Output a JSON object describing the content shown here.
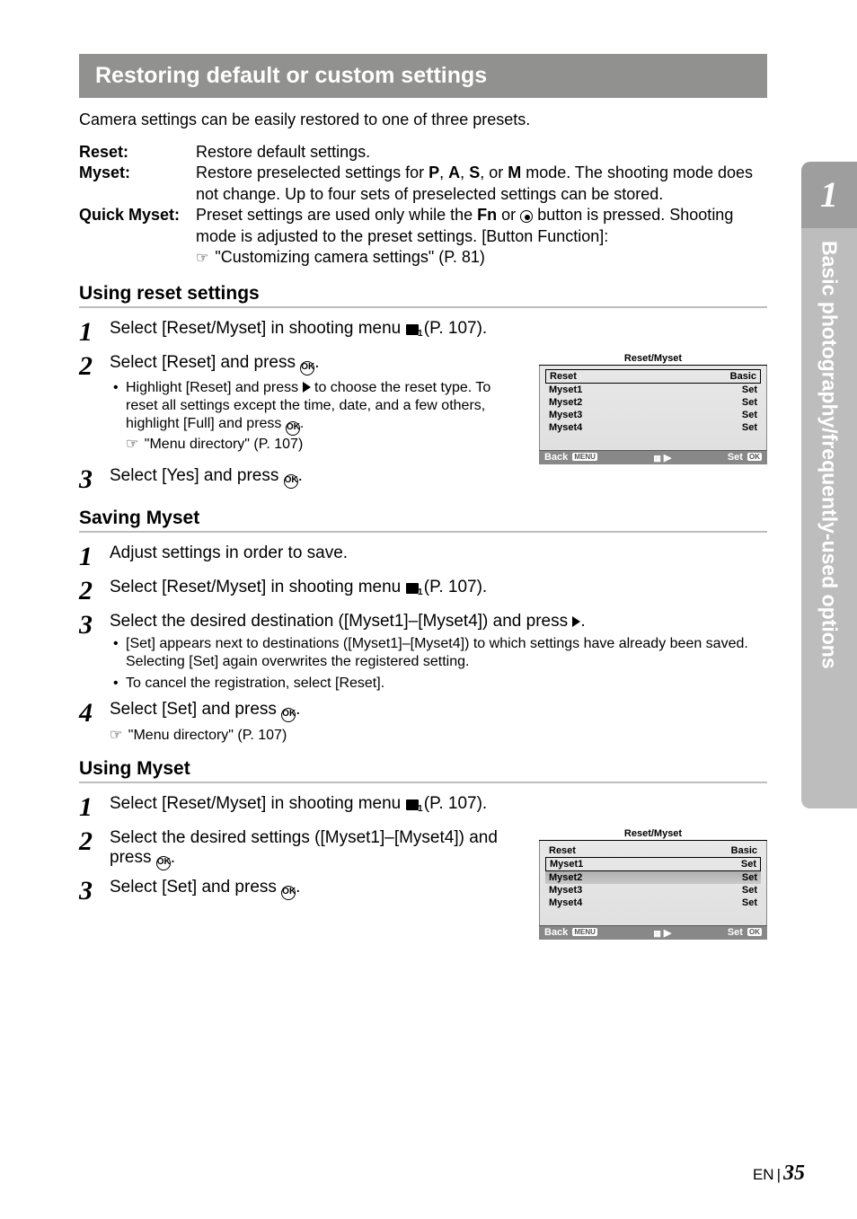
{
  "sideTab": {
    "number": "1",
    "label": "Basic photography/frequently-used options"
  },
  "heading": "Restoring default or custom settings",
  "intro": "Camera settings can be easily restored to one of three presets.",
  "defs": {
    "reset": {
      "label": "Reset:",
      "body": "Restore default settings."
    },
    "myset": {
      "label": "Myset:",
      "body_a": "Restore preselected settings for ",
      "modes": {
        "p": "P",
        "a": "A",
        "s": "S",
        "m": "M"
      },
      "body_b": " mode. The shooting mode does not change. Up to four sets of preselected settings can be stored.",
      "sep": ", ",
      "or": ", or "
    },
    "quick": {
      "label": "Quick Myset:",
      "body_a": "Preset settings are used only while the ",
      "fn": "Fn",
      "body_b": " or ",
      "body_c": " button is pressed. Shooting mode is adjusted to the preset settings. ",
      "btnfn": "[Button Function]",
      "colon": ":",
      "ref": " \"Customizing camera settings\" (P. 81)"
    }
  },
  "sections": {
    "usingReset": {
      "title": "Using reset settings",
      "step1": {
        "a": "Select [Reset/Myset] in shooting menu ",
        "b": " (P. 107)."
      },
      "step2": {
        "main": "Select [Reset] and press ",
        "end": ".",
        "bullet1a": "Highlight [Reset] and press ",
        "bullet1b": " to choose the reset type. To reset all settings except the time, date, and a few others, highlight [Full] and press ",
        "bullet1c": ".",
        "ref": " \"Menu directory\" (P. 107)"
      },
      "step3": {
        "main": "Select [Yes] and press ",
        "end": "."
      }
    },
    "savingMyset": {
      "title": "Saving Myset",
      "step1": "Adjust settings in order to save.",
      "step2": {
        "a": "Select [Reset/Myset] in shooting menu ",
        "b": " (P. 107)."
      },
      "step3": {
        "main": "Select the desired destination ([Myset1]–[Myset4]) and press ",
        "end": ".",
        "bullet1": "[Set] appears next to destinations ([Myset1]–[Myset4]) to which settings have already been saved. Selecting [Set] again overwrites the registered setting.",
        "bullet2": "To cancel the registration, select [Reset]."
      },
      "step4": {
        "main": "Select [Set] and press ",
        "end": ".",
        "ref": " \"Menu directory\" (P. 107)"
      }
    },
    "usingMyset": {
      "title": "Using Myset",
      "step1": {
        "a": "Select [Reset/Myset] in shooting menu ",
        "b": " (P. 107)."
      },
      "step2": {
        "main": "Select the desired settings ([Myset1]–[Myset4]) and press ",
        "end": "."
      },
      "step3": {
        "main": "Select [Set] and press ",
        "end": "."
      }
    }
  },
  "camScreen": {
    "title": "Reset/Myset",
    "rows": [
      {
        "label": "Reset",
        "value": "Basic"
      },
      {
        "label": "Myset1",
        "value": "Set"
      },
      {
        "label": "Myset2",
        "value": "Set"
      },
      {
        "label": "Myset3",
        "value": "Set"
      },
      {
        "label": "Myset4",
        "value": "Set"
      }
    ],
    "footer": {
      "back": "Back",
      "backBadge": "MENU",
      "mid": "▶",
      "set": "Set",
      "setBadge": "OK"
    }
  },
  "footer": {
    "lang": "EN",
    "page": "35"
  }
}
